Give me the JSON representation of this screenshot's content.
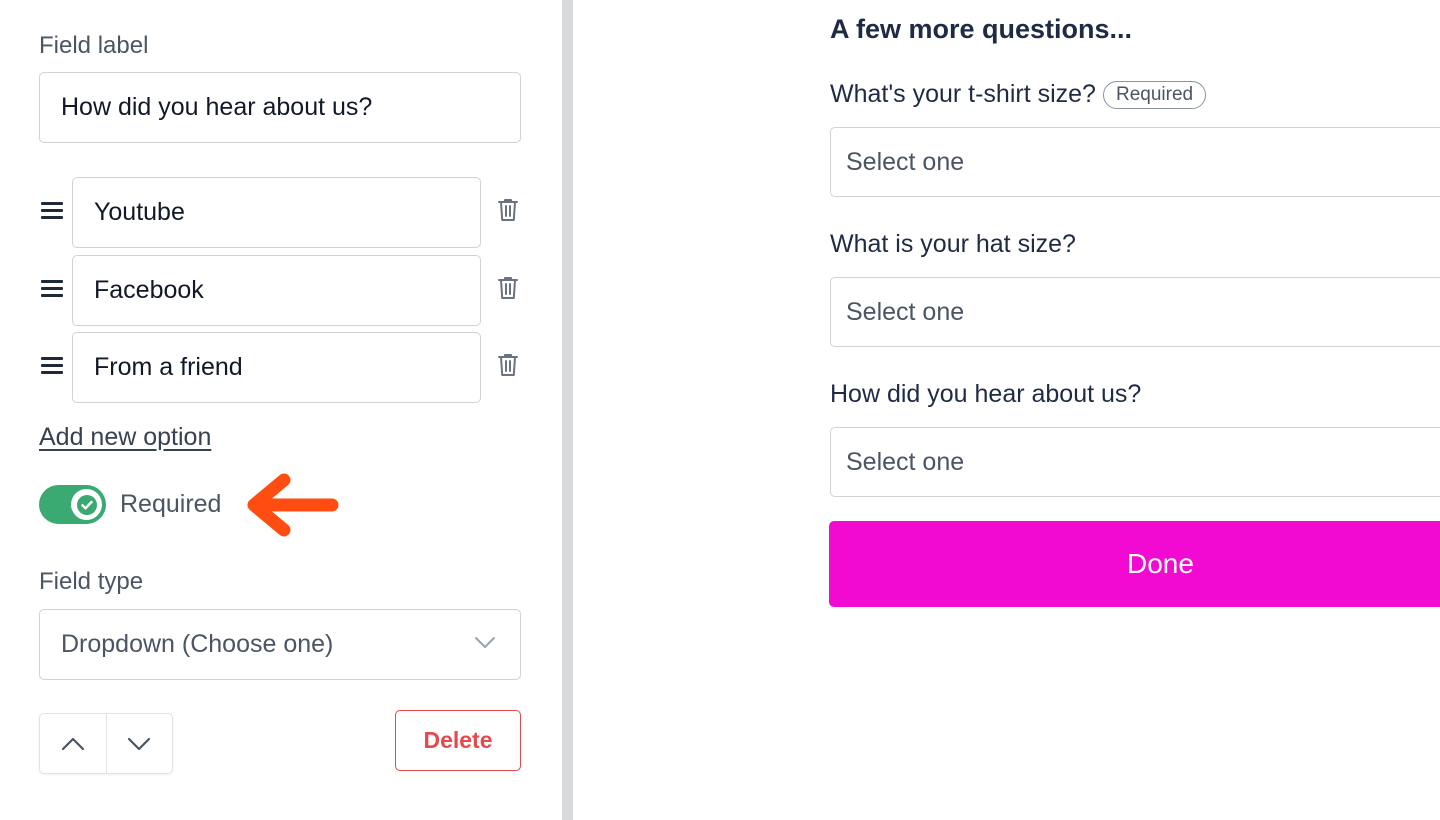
{
  "editor": {
    "field_label_caption": "Field label",
    "field_label_value": "How did you hear about us?",
    "options": [
      {
        "value": "Youtube"
      },
      {
        "value": "Facebook"
      },
      {
        "value": "From a friend"
      }
    ],
    "add_option_label": "Add new option",
    "required_toggle": {
      "label": "Required",
      "on": true
    },
    "field_type_caption": "Field type",
    "field_type_value": "Dropdown (Choose one)",
    "delete_label": "Delete"
  },
  "preview": {
    "title": "A few more questions...",
    "questions": [
      {
        "label": "What's your t-shirt size?",
        "badge": "Required",
        "placeholder": "Select one"
      },
      {
        "label": "What is your hat size?",
        "placeholder": "Select one"
      },
      {
        "label": "How did you hear about us?",
        "placeholder": "Select one"
      }
    ],
    "done_label": "Done"
  },
  "colors": {
    "toggle_on": "#3aa972",
    "done_button": "#f20ad3",
    "delete_accent": "#e5484d",
    "annotation_arrow": "#ff4d12"
  }
}
